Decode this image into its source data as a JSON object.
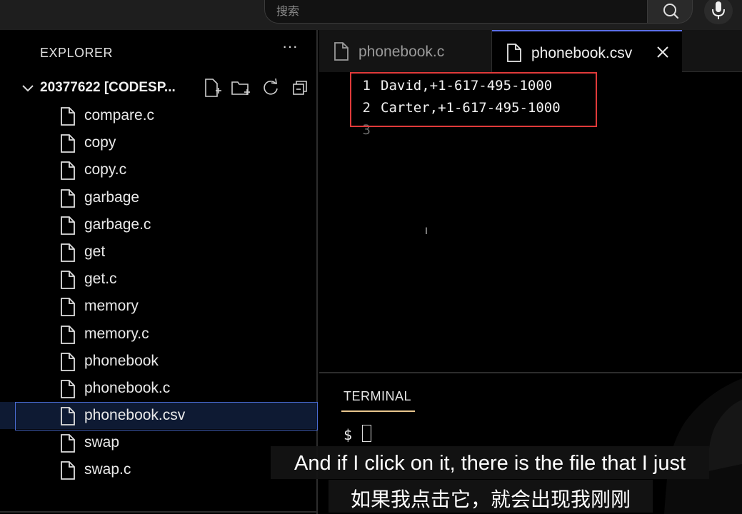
{
  "topbar": {
    "search_placeholder": "搜索",
    "search_icon": "search-icon",
    "mic_icon": "microphone-icon"
  },
  "sidebar": {
    "title": "EXPLORER",
    "more_actions": "···",
    "folder": {
      "name": "20377622 [CODESP...",
      "actions": [
        "new-file-icon",
        "new-folder-icon",
        "refresh-icon",
        "collapse-all-icon"
      ]
    },
    "files": [
      {
        "label": "compare.c"
      },
      {
        "label": "copy"
      },
      {
        "label": "copy.c"
      },
      {
        "label": "garbage"
      },
      {
        "label": "garbage.c"
      },
      {
        "label": "get"
      },
      {
        "label": "get.c"
      },
      {
        "label": "memory"
      },
      {
        "label": "memory.c"
      },
      {
        "label": "phonebook"
      },
      {
        "label": "phonebook.c"
      },
      {
        "label": "phonebook.csv",
        "selected": true
      },
      {
        "label": "swap"
      },
      {
        "label": "swap.c"
      }
    ]
  },
  "editor": {
    "tabs": [
      {
        "label": "phonebook.c",
        "active": false
      },
      {
        "label": "phonebook.csv",
        "active": true
      }
    ],
    "lines": [
      {
        "number": "1",
        "text": "David,+1-617-495-1000"
      },
      {
        "number": "2",
        "text": "Carter,+1-617-495-1000"
      },
      {
        "number": "3",
        "text": ""
      }
    ],
    "highlight_color": "#e03a3a"
  },
  "panel": {
    "tab_label": "TERMINAL",
    "prompt": "$"
  },
  "subtitles": {
    "english": "And if I click on it, there is the file that I just",
    "chinese": "如果我点击它，就会出现我刚刚"
  },
  "colors": {
    "accent": "#5b6ee8",
    "terminal_underline": "#e8c68e",
    "selection_border": "#4a6cd4"
  }
}
